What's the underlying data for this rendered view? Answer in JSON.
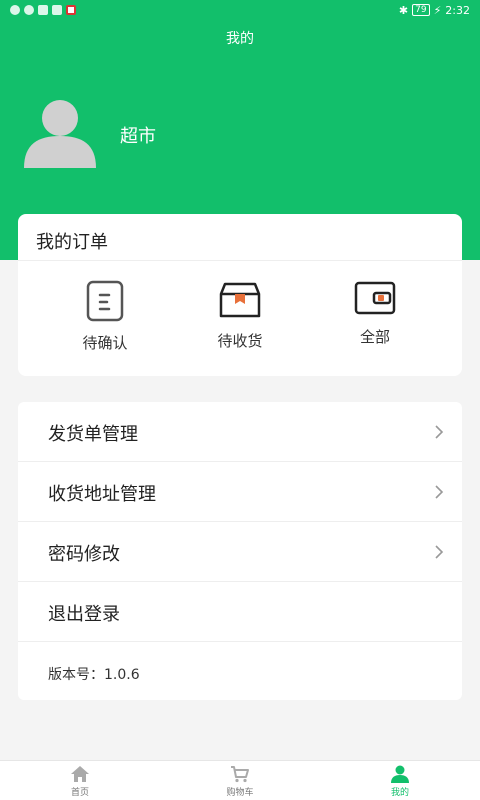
{
  "status_bar": {
    "time": "2:32",
    "battery": "79"
  },
  "page_title": "我的",
  "profile": {
    "name": "超市"
  },
  "orders": {
    "title": "我的订单",
    "items": [
      {
        "label": "待确认",
        "icon": "clipboard-icon"
      },
      {
        "label": "待收货",
        "icon": "package-box-icon"
      },
      {
        "label": "全部",
        "icon": "wallet-icon"
      }
    ]
  },
  "menu": {
    "items": [
      {
        "label": "发货单管理"
      },
      {
        "label": "收货地址管理"
      },
      {
        "label": "密码修改"
      },
      {
        "label": "退出登录"
      }
    ],
    "version": "版本号：1.0.6"
  },
  "tabbar": {
    "tabs": [
      {
        "label": "首页",
        "icon": "home-icon"
      },
      {
        "label": "购物车",
        "icon": "cart-icon"
      },
      {
        "label": "我的",
        "icon": "user-icon"
      }
    ]
  },
  "colors": {
    "brand": "#12bf6b",
    "accent_orange": "#e8703a"
  }
}
